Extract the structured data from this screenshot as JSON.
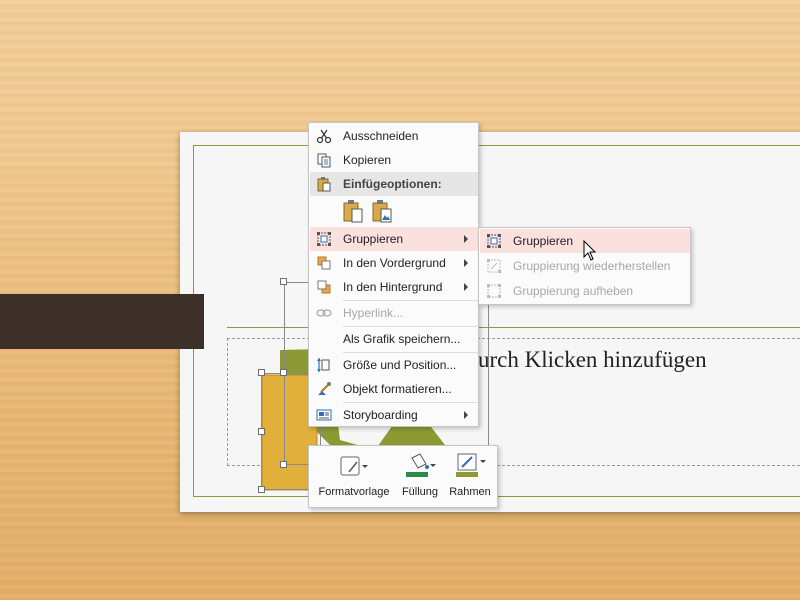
{
  "slide": {
    "placeholder_text": "urch Klicken hinzufügen"
  },
  "context_menu": {
    "items": [
      {
        "id": "cut",
        "label": "Ausschneiden",
        "icon": "scissors-icon"
      },
      {
        "id": "copy",
        "label": "Kopieren",
        "icon": "copy-icon"
      },
      {
        "id": "paste_options",
        "label": "Einfügeoptionen:",
        "icon": "paste-icon"
      },
      {
        "id": "group",
        "label": "Gruppieren",
        "icon": "group-icon"
      },
      {
        "id": "bring_forward",
        "label": "In den Vordergrund",
        "icon": "bring-forward-icon"
      },
      {
        "id": "send_backward",
        "label": "In den Hintergrund",
        "icon": "send-backward-icon"
      },
      {
        "id": "hyperlink",
        "label": "Hyperlink...",
        "icon": "hyperlink-icon"
      },
      {
        "id": "save_as_picture",
        "label": "Als Grafik speichern..."
      },
      {
        "id": "size_position",
        "label": "Größe und Position...",
        "icon": "size-position-icon"
      },
      {
        "id": "format_object",
        "label": "Objekt formatieren...",
        "icon": "format-object-icon"
      },
      {
        "id": "storyboarding",
        "label": "Storyboarding",
        "icon": "storyboard-icon"
      }
    ],
    "paste_buttons": [
      "paste-keep-formatting-icon",
      "paste-as-picture-icon"
    ]
  },
  "submenu": {
    "items": [
      {
        "label": "Gruppieren",
        "icon": "group-icon"
      },
      {
        "label": "Gruppierung wiederherstellen",
        "icon": "regroup-icon"
      },
      {
        "label": "Gruppierung aufheben",
        "icon": "ungroup-icon"
      }
    ]
  },
  "mini_toolbar": {
    "buttons": [
      {
        "label": "Formatvorlage",
        "icon": "shape-style-icon"
      },
      {
        "label": "Füllung",
        "icon": "fill-bucket-icon"
      },
      {
        "label": "Rahmen",
        "icon": "outline-pen-icon"
      }
    ]
  },
  "colors": {
    "accent_olive": "#8e9a3a",
    "shape_gold": "#e0b03a",
    "shape_olive": "#8c9a34",
    "highlight": "#fbe1dd",
    "dark_bar": "#3d3028"
  }
}
